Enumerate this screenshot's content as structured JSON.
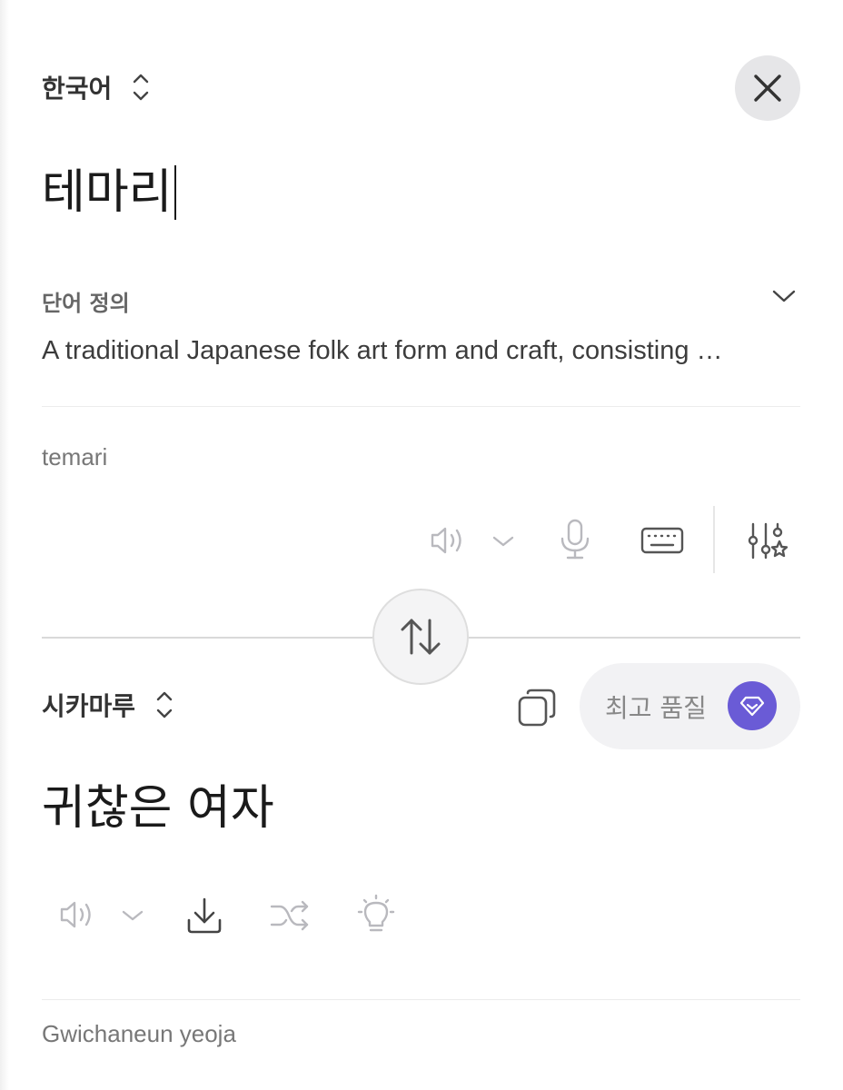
{
  "source": {
    "language": "한국어",
    "text": "테마리",
    "definition_title": "단어 정의",
    "definition_text": "A traditional Japanese folk art form and craft, consisting …",
    "transliteration": "temari"
  },
  "target": {
    "language": "시카마루",
    "quality_label": "최고 품질",
    "text": "귀찮은 여자",
    "transliteration": "Gwichaneun yeoja"
  },
  "colors": {
    "accent": "#6a5bd6",
    "close_bg": "#e6e6e8",
    "pill_bg": "#f2f2f4"
  }
}
